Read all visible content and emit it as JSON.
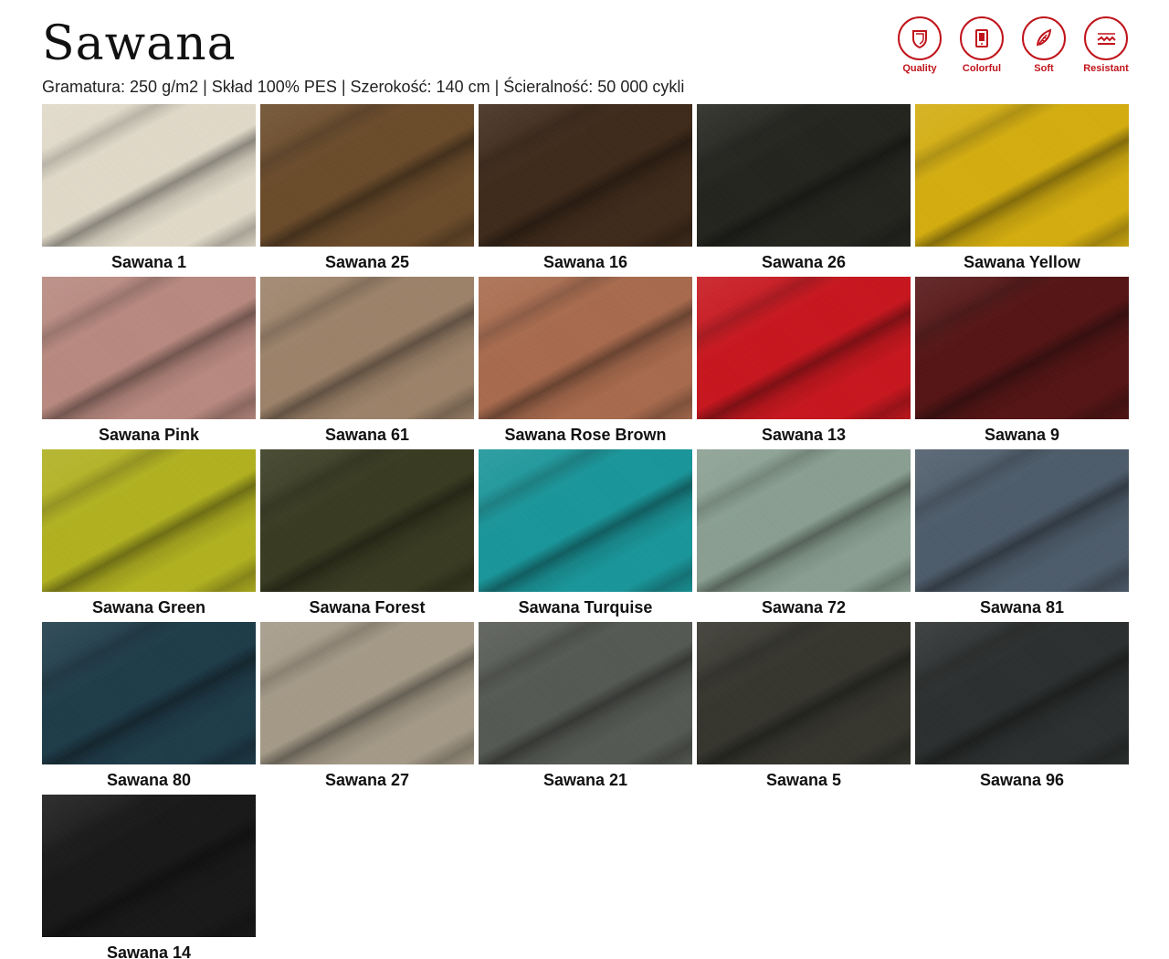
{
  "header": {
    "title": "Sawana",
    "specs": "Gramatura: 250 g/m2 | Skład 100% PES | Szerokość: 140 cm | Ścieralność: 50 000 cykli"
  },
  "badges": [
    {
      "label": "Quality",
      "icon": "shield-icon"
    },
    {
      "label": "Colorful",
      "icon": "swatch-card-icon"
    },
    {
      "label": "Soft",
      "icon": "feather-icon"
    },
    {
      "label": "Resistant",
      "icon": "abrasion-icon"
    }
  ],
  "accent_color": "#c0141b",
  "swatches": [
    {
      "name": "Sawana 1",
      "color": "#e3dccb"
    },
    {
      "name": "Sawana 25",
      "color": "#6a4a28"
    },
    {
      "name": "Sawana 16",
      "color": "#3d2818"
    },
    {
      "name": "Sawana 26",
      "color": "#22221d"
    },
    {
      "name": "Sawana Yellow",
      "color": "#d5ae0c"
    },
    {
      "name": "Sawana Pink",
      "color": "#b9897f"
    },
    {
      "name": "Sawana 61",
      "color": "#9d8269"
    },
    {
      "name": "Sawana Rose Brown",
      "color": "#a96a4c"
    },
    {
      "name": "Sawana 13",
      "color": "#c9141c"
    },
    {
      "name": "Sawana 9",
      "color": "#541213"
    },
    {
      "name": "Sawana Green",
      "color": "#b2b21e"
    },
    {
      "name": "Sawana Forest",
      "color": "#37391f"
    },
    {
      "name": "Sawana Turquise",
      "color": "#17969a"
    },
    {
      "name": "Sawana 72",
      "color": "#8aa092"
    },
    {
      "name": "Sawana 81",
      "color": "#4c5b6a"
    },
    {
      "name": "Sawana 80",
      "color": "#1c3a48"
    },
    {
      "name": "Sawana 27",
      "color": "#a59a87"
    },
    {
      "name": "Sawana 21",
      "color": "#545852"
    },
    {
      "name": "Sawana 5",
      "color": "#34342c"
    },
    {
      "name": "Sawana 96",
      "color": "#2a2d2d"
    },
    {
      "name": "Sawana 14",
      "color": "#161616"
    }
  ]
}
